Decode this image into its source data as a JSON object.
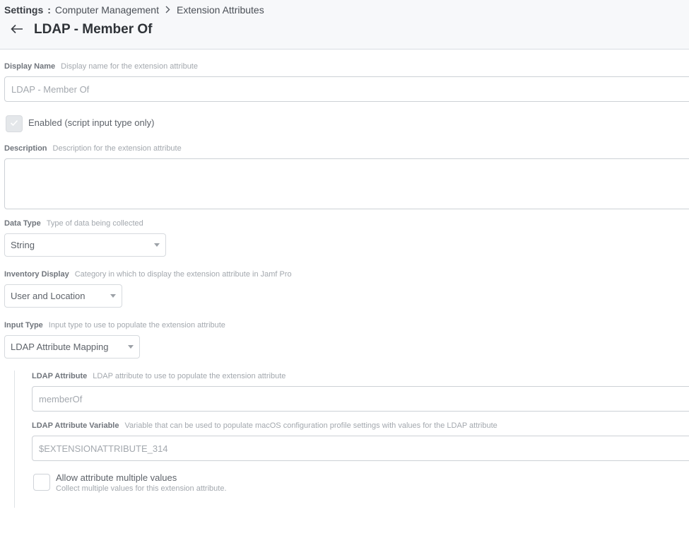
{
  "breadcrumb": {
    "root": "Settings",
    "separator": ":",
    "items": [
      "Computer Management",
      "Extension Attributes"
    ]
  },
  "page": {
    "title": "LDAP - Member Of"
  },
  "fields": {
    "display_name": {
      "label": "Display Name",
      "hint": "Display name for the extension attribute",
      "value": "LDAP - Member Of"
    },
    "enabled": {
      "label": "Enabled (script input type only)",
      "checked": true
    },
    "description": {
      "label": "Description",
      "hint": "Description for the extension attribute",
      "value": ""
    },
    "data_type": {
      "label": "Data Type",
      "hint": "Type of data being collected",
      "value": "String"
    },
    "inventory_display": {
      "label": "Inventory Display",
      "hint": "Category in which to display the extension attribute in Jamf Pro",
      "value": "User and Location"
    },
    "input_type": {
      "label": "Input Type",
      "hint": "Input type to use to populate the extension attribute",
      "value": "LDAP Attribute Mapping"
    },
    "ldap_attribute": {
      "label": "LDAP Attribute",
      "hint": "LDAP attribute to use to populate the extension attribute",
      "value": "memberOf"
    },
    "ldap_attribute_variable": {
      "label": "LDAP Attribute Variable",
      "hint": "Variable that can be used to populate macOS configuration profile settings with values for the LDAP attribute",
      "value": "$EXTENSIONATTRIBUTE_314"
    },
    "allow_multiple": {
      "label": "Allow attribute multiple values",
      "sublabel": "Collect multiple values for this extension attribute.",
      "checked": false
    }
  },
  "icons": {
    "back": "arrow-left-icon",
    "chevron": "chevron-right-icon",
    "check": "checkmark-icon",
    "dropdown": "caret-down-icon"
  },
  "colors": {
    "header_bg": "#f7f8fa",
    "border": "#cdd1d6",
    "label": "#70757c",
    "hint": "#a3a8ae"
  }
}
